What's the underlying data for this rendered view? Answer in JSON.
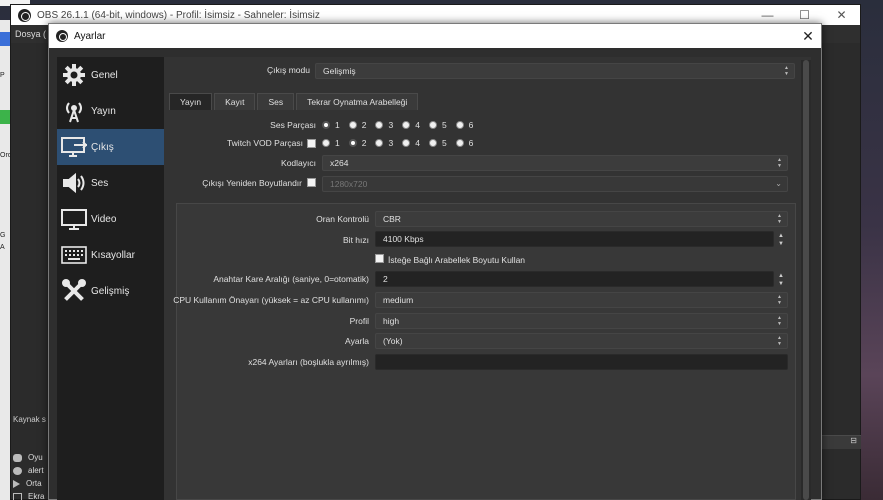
{
  "desktop": {
    "left_labels": [
      "P",
      "Orc",
      "G",
      "A"
    ]
  },
  "obs": {
    "title": "OBS 26.1.1 (64-bit, windows) - Profil: İsimsiz - Sahneler: İsimsiz",
    "menu_first": "Dosya (",
    "sources_label": "Kaynak s",
    "sources": [
      "Oyu",
      "alert",
      "Orta",
      "Ekra"
    ],
    "min_glyph": "—",
    "max_glyph": "☐",
    "close_glyph": "✕"
  },
  "dialog": {
    "title": "Ayarlar",
    "close_glyph": "✕",
    "sidebar": [
      {
        "label": "Genel",
        "icon": "gear-icon"
      },
      {
        "label": "Yayın",
        "icon": "broadcast-icon"
      },
      {
        "label": "Çıkış",
        "icon": "monitor-output-icon",
        "active": true
      },
      {
        "label": "Ses",
        "icon": "speaker-icon"
      },
      {
        "label": "Video",
        "icon": "monitor-icon"
      },
      {
        "label": "Kısayollar",
        "icon": "keyboard-icon"
      },
      {
        "label": "Gelişmiş",
        "icon": "tools-icon"
      }
    ],
    "output_mode": {
      "label": "Çıkış modu",
      "value": "Gelişmiş"
    },
    "tabs": [
      "Yayın",
      "Kayıt",
      "Ses",
      "Tekrar Oynatma Arabelleği"
    ],
    "audio_track": {
      "label": "Ses Parçası",
      "tracks": [
        "1",
        "2",
        "3",
        "4",
        "5",
        "6"
      ],
      "selected": 1
    },
    "twitch_vod": {
      "label": "Twitch VOD Parçası",
      "tracks": [
        "1",
        "2",
        "3",
        "4",
        "5",
        "6"
      ],
      "selected": 2
    },
    "encoder": {
      "label": "Kodlayıcı",
      "value": "x264"
    },
    "rescale": {
      "label": "Çıkışı Yeniden Boyutlandır",
      "value": "1280x720"
    },
    "rate_control": {
      "label": "Oran Kontrolü",
      "value": "CBR"
    },
    "bitrate": {
      "label": "Bit hızı",
      "value": "4100 Kbps"
    },
    "custom_buffer": {
      "label": "İsteğe Bağlı Arabellek Boyutu Kullan"
    },
    "keyframe": {
      "label": "Anahtar Kare Aralığı (saniye, 0=otomatik)",
      "value": "2"
    },
    "cpu_preset": {
      "label": "CPU Kullanım Önayarı (yüksek = az CPU kullanımı)",
      "value": "medium"
    },
    "profile": {
      "label": "Profil",
      "value": "high"
    },
    "tune": {
      "label": "Ayarla",
      "value": "(Yok)"
    },
    "x264_opts": {
      "label": "x264 Ayarları (boşlukla ayrılmış)",
      "value": ""
    }
  }
}
